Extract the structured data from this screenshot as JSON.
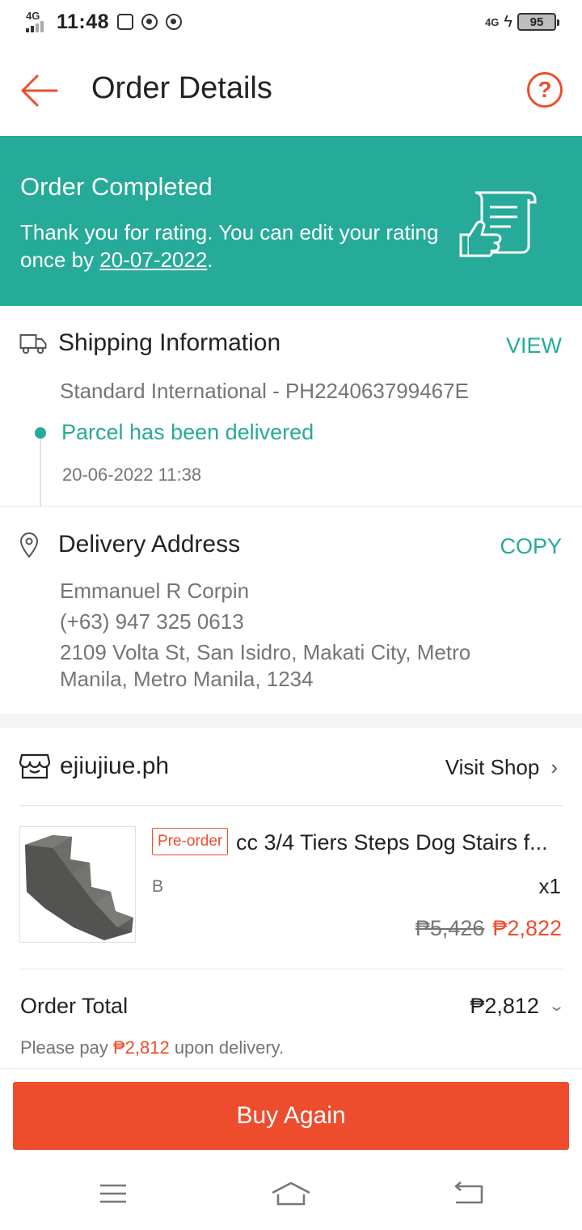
{
  "status_bar": {
    "network_left": "4G",
    "time": "11:48",
    "network_right": "4G",
    "battery": "95",
    "icons": [
      "signal-icon",
      "gallery-icon",
      "chrome-icon",
      "chrome-icon",
      "charging-icon",
      "battery-icon"
    ]
  },
  "header": {
    "title": "Order Details",
    "help_label": "?"
  },
  "banner": {
    "title": "Order Completed",
    "text_before": "Thank you for rating. You can edit your rating once by ",
    "date": "20-07-2022",
    "text_after": "."
  },
  "shipping": {
    "title": "Shipping Information",
    "action": "VIEW",
    "carrier": "Standard International - PH224063799467E",
    "status": "Parcel has been delivered",
    "time": "20-06-2022 11:38"
  },
  "address": {
    "title": "Delivery Address",
    "action": "COPY",
    "name": "Emmanuel R Corpin",
    "phone": "(+63) 947 325 0613",
    "line1": "2109 Volta St, San Isidro, Makati City, Metro",
    "line2": "Manila, Metro Manila, 1234"
  },
  "shop": {
    "name": "ejiujiue.ph",
    "visit_label": "Visit Shop",
    "product": {
      "badge": "Pre-order",
      "name": "cc 3/4 Tiers Steps Dog Stairs f...",
      "variant": "B",
      "quantity": "x1",
      "original_price": "₱5,426",
      "price": "₱2,822"
    },
    "order_total_label": "Order Total",
    "order_total": "₱2,812",
    "pay_before": "Please pay ",
    "pay_amount": "₱2,812",
    "pay_after": " upon delivery."
  },
  "buy_again_label": "Buy Again",
  "colors": {
    "brand": "#ee4d2d",
    "teal": "#26aa99",
    "muted": "#757575"
  }
}
